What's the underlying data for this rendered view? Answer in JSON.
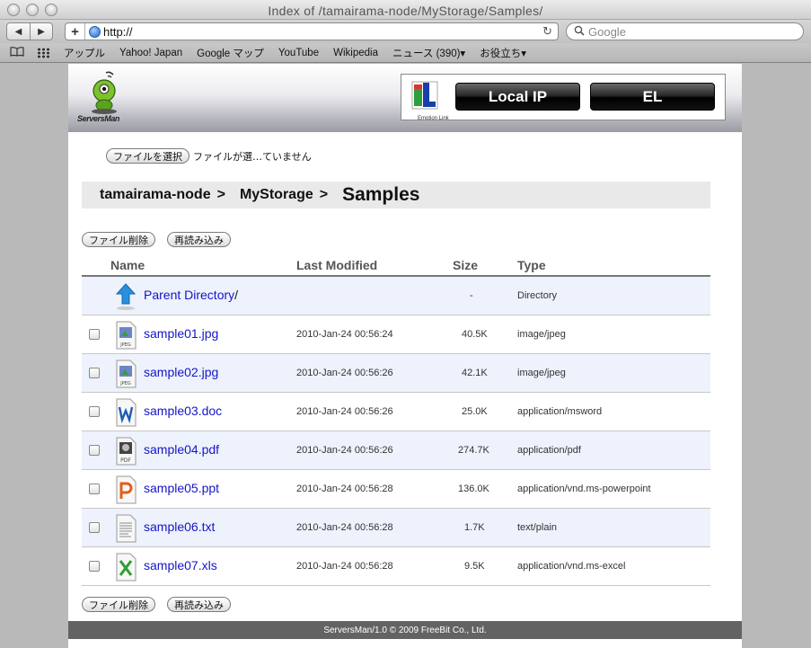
{
  "browser": {
    "window_title": "Index of /tamairama-node/MyStorage/Samples/",
    "url": "http://",
    "search_placeholder": "Google",
    "back_glyph": "◀",
    "forward_glyph": "▶",
    "add_glyph": "+",
    "reload_glyph": "↻",
    "bookmarks": [
      "アップル",
      "Yahoo! Japan",
      "Google マップ",
      "YouTube",
      "Wikipedia",
      "ニュース (390)▾",
      "お役立ち▾"
    ]
  },
  "header": {
    "logo_text": "ServersMan",
    "el_logo_text": "Emotion Link",
    "local_ip_button": "Local IP",
    "el_button": "EL"
  },
  "upload": {
    "choose_file_button": "ファイルを選択",
    "no_file_text": "ファイルが選…ていません"
  },
  "breadcrumb": {
    "parts": [
      "tamairama-node",
      "MyStorage"
    ],
    "separator": ">",
    "current": "Samples"
  },
  "actions": {
    "delete_label": "ファイル削除",
    "reload_label": "再読み込み"
  },
  "table": {
    "columns": [
      "Name",
      "Last Modified",
      "Size",
      "Type"
    ],
    "parent": {
      "name": "Parent Directory",
      "suffix": "/",
      "size": "-",
      "type": "Directory"
    },
    "files": [
      {
        "name": "sample01.jpg",
        "modified": "2010-Jan-24 00:56:24",
        "size": "40.5K",
        "type": "image/jpeg",
        "icon": "jpeg-file-icon"
      },
      {
        "name": "sample02.jpg",
        "modified": "2010-Jan-24 00:56:26",
        "size": "42.1K",
        "type": "image/jpeg",
        "icon": "jpeg-file-icon"
      },
      {
        "name": "sample03.doc",
        "modified": "2010-Jan-24 00:56:26",
        "size": "25.0K",
        "type": "application/msword",
        "icon": "word-file-icon"
      },
      {
        "name": "sample04.pdf",
        "modified": "2010-Jan-24 00:56:26",
        "size": "274.7K",
        "type": "application/pdf",
        "icon": "pdf-file-icon"
      },
      {
        "name": "sample05.ppt",
        "modified": "2010-Jan-24 00:56:28",
        "size": "136.0K",
        "type": "application/vnd.ms-powerpoint",
        "icon": "powerpoint-file-icon"
      },
      {
        "name": "sample06.txt",
        "modified": "2010-Jan-24 00:56:28",
        "size": "1.7K",
        "type": "text/plain",
        "icon": "text-file-icon"
      },
      {
        "name": "sample07.xls",
        "modified": "2010-Jan-24 00:56:28",
        "size": "9.5K",
        "type": "application/vnd.ms-excel",
        "icon": "excel-file-icon"
      }
    ]
  },
  "footer": {
    "text": "ServersMan/1.0 © 2009 FreeBit Co., Ltd."
  },
  "colors": {
    "link": "#1515c8",
    "row_alt": "#edf2fc",
    "footer_bg": "#636363"
  }
}
